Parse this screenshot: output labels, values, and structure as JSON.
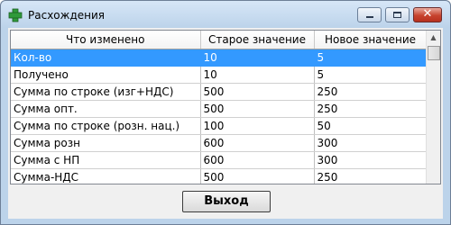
{
  "window": {
    "title": "Расхождения"
  },
  "table": {
    "headers": [
      "Что изменено",
      "Старое значение",
      "Новое значение"
    ],
    "rows": [
      [
        "Кол-во",
        "10",
        "5"
      ],
      [
        "Получено",
        "10",
        "5"
      ],
      [
        "Сумма по строке (изг+НДС)",
        "500",
        "250"
      ],
      [
        "Сумма опт.",
        "500",
        "250"
      ],
      [
        "Сумма по строке (розн. нац.)",
        "100",
        "50"
      ],
      [
        "Сумма розн",
        "600",
        "300"
      ],
      [
        "Сумма с НП",
        "600",
        "300"
      ],
      [
        "Сумма-НДС",
        "500",
        "250"
      ]
    ],
    "selected_row": 0
  },
  "buttons": {
    "exit_label": "Выход"
  },
  "icons": {
    "app": "plus-cross-icon",
    "minimize": "minimize-icon",
    "maximize": "maximize-icon",
    "close": "close-icon"
  }
}
